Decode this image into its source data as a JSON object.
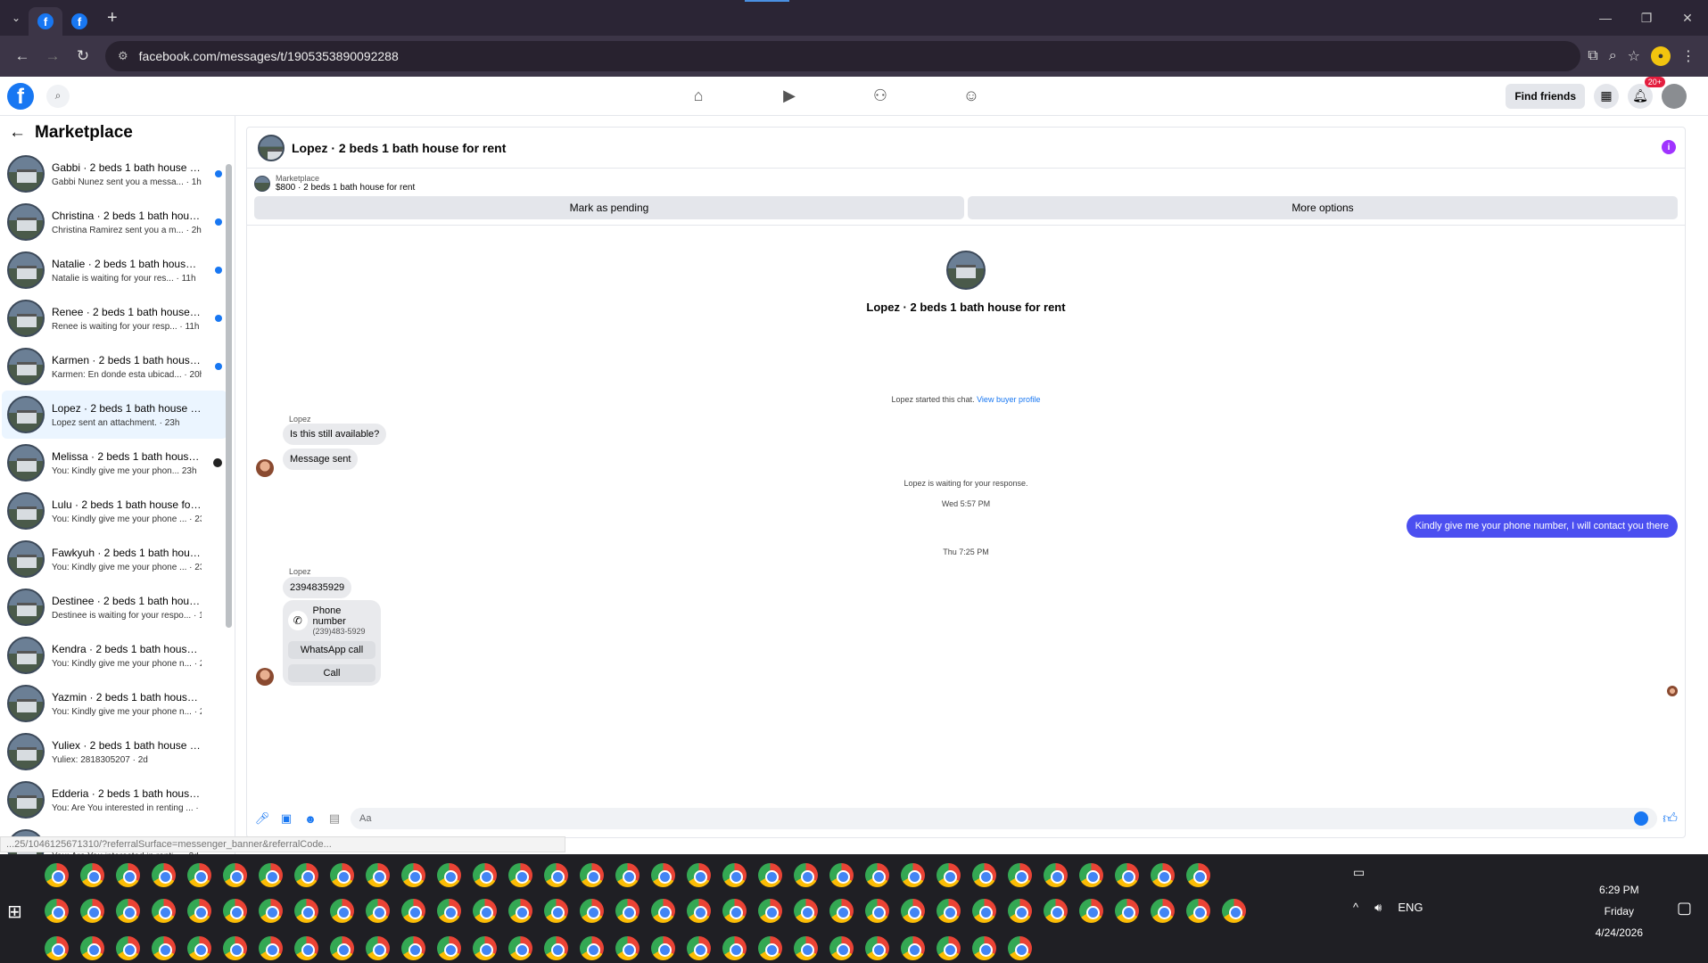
{
  "browser": {
    "url": "facebook.com/messages/t/1905353890092288",
    "tabs": [
      "f",
      "f"
    ],
    "new_tab": "+"
  },
  "fb_header": {
    "find_friends": "Find friends",
    "notifications_badge": "20+"
  },
  "sidebar": {
    "title": "Marketplace",
    "conversations": [
      {
        "title": "Gabbi · 2 beds 1 bath house f...",
        "subtitle": "Gabbi Nunez sent you a messa... · 1h",
        "unread": true
      },
      {
        "title": "Christina · 2 beds 1 bath hous...",
        "subtitle": "Christina Ramirez sent you a m... · 2h",
        "unread": true
      },
      {
        "title": "Natalie · 2 beds 1 bath house ...",
        "subtitle": "Natalie is waiting for your res... · 11h",
        "unread": true
      },
      {
        "title": "Renee · 2 beds 1 bath house f...",
        "subtitle": "Renee is waiting for your resp... · 11h",
        "unread": true
      },
      {
        "title": "Karmen · 2 beds 1 bath house ...",
        "subtitle": "Karmen: En donde esta ubicad... · 20h",
        "unread": true
      },
      {
        "title": "Lopez · 2 beds 1 bath house for ...",
        "subtitle": "Lopez sent an attachment. · 23h",
        "unread": false,
        "selected": true
      },
      {
        "title": "Melissa · 2 beds 1 bath house...",
        "subtitle": "You: Kindly give me your phon... 23h",
        "unread": false,
        "seen": true
      },
      {
        "title": "Lulu · 2 beds 1 bath house for r...",
        "subtitle": "You: Kindly give me your phone ... · 23h",
        "unread": false
      },
      {
        "title": "Fawkyuh · 2 beds 1 bath house f...",
        "subtitle": "You: Kindly give me your phone ... · 23h",
        "unread": false
      },
      {
        "title": "Destinee · 2 beds 1 bath house f...",
        "subtitle": "Destinee is waiting for your respo... · 1d",
        "unread": false
      },
      {
        "title": "Kendra · 2 beds 1 bath house fo...",
        "subtitle": "You: Kindly give me your phone n... · 2d",
        "unread": false
      },
      {
        "title": "Yazmin · 2 beds 1 bath house fo...",
        "subtitle": "You: Kindly give me your phone n... · 2d",
        "unread": false
      },
      {
        "title": "Yuliex · 2 beds 1 bath house for ...",
        "subtitle": "Yuliex: 2818305207 · 2d",
        "unread": false
      },
      {
        "title": "Edderia · 2 beds 1 bath house f...",
        "subtitle": "You: Are You interested in renting ... · 2d",
        "unread": false
      },
      {
        "title": "Grisel · 2 beds 1 bath house fo...",
        "subtitle": "You: Are You interested in renti... · 2d",
        "unread": false
      }
    ]
  },
  "chat": {
    "title": "Lopez · 2 beds 1 bath house for rent",
    "marketplace_label": "Marketplace",
    "listing": "$800 · 2 beds 1 bath house for rent",
    "mark_pending": "Mark as pending",
    "more_options": "More options",
    "profile_title": "Lopez · 2 beds 1 bath house for rent",
    "started_text": "Lopez started this chat.",
    "view_profile": "View buyer profile",
    "sender1": "Lopez",
    "msg1": "Is this still available?",
    "msg2": "Message sent",
    "waiting": "Lopez is waiting for your response.",
    "time1": "Wed 5:57 PM",
    "mine1": "Kindly give me your phone number, I will contact you there",
    "time2": "Thu 7:25 PM",
    "sender2": "Lopez",
    "msg3": "2394835929",
    "phone_label": "Phone number",
    "phone_value": "(239)483-5929",
    "whatsapp_btn": "WhatsApp call",
    "call_btn": "Call",
    "composer_placeholder": "Aa"
  },
  "status_url": "...25/1046125671310/?referralSurface=messenger_banner&referralCode...",
  "taskbar": {
    "time": "6:29 PM",
    "day": "Friday",
    "date": "4/24/2026",
    "lang": "ENG",
    "row1_count": 33,
    "row2_count": 34,
    "row3_count": 28
  }
}
